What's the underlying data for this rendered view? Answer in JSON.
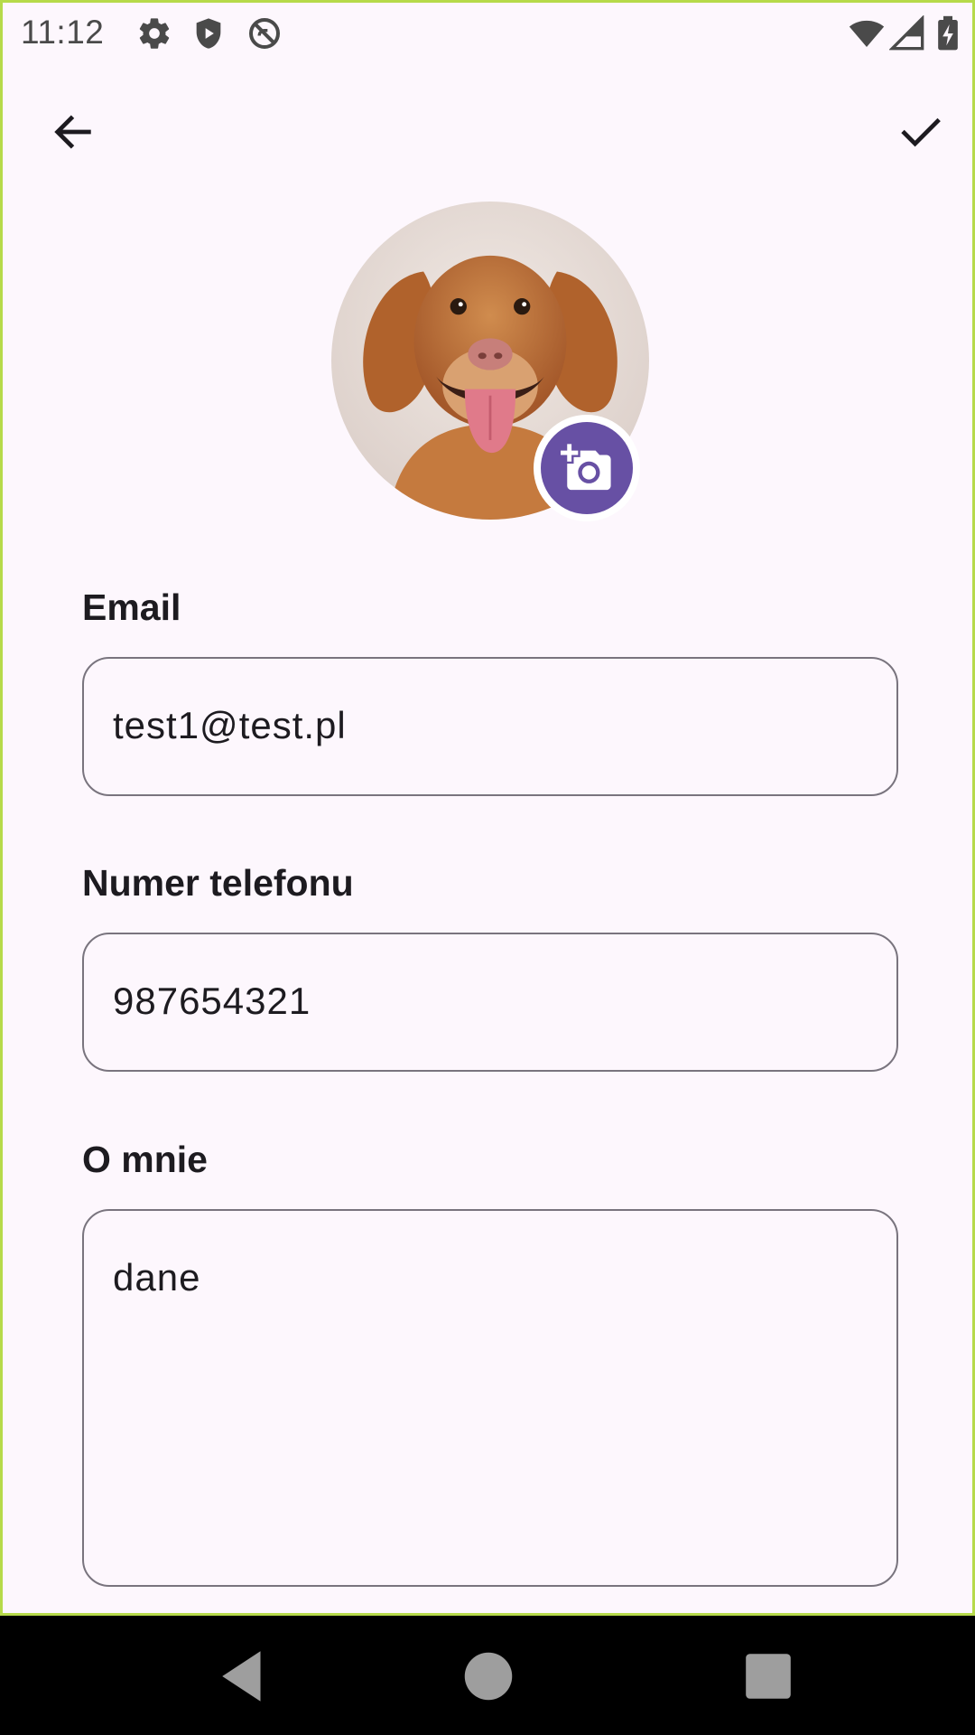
{
  "status_bar": {
    "time": "11:12",
    "icons": [
      "settings-icon",
      "shield-icon",
      "no-sync-icon",
      "wifi-icon",
      "signal-icon",
      "battery-charging-icon"
    ]
  },
  "app_bar": {
    "back_icon": "arrow-back-icon",
    "save_icon": "check-icon"
  },
  "profile": {
    "avatar": "dog-photo",
    "change_photo_icon": "add-a-photo-icon",
    "accent_color": "#6750A4"
  },
  "form": {
    "email": {
      "label": "Email",
      "value": "test1@test.pl"
    },
    "phone": {
      "label": "Numer telefonu",
      "value": "987654321"
    },
    "about": {
      "label": "O mnie",
      "value": "dane"
    }
  },
  "nav_bar": {
    "icons": [
      "back-triangle-icon",
      "home-circle-icon",
      "recents-square-icon"
    ]
  }
}
